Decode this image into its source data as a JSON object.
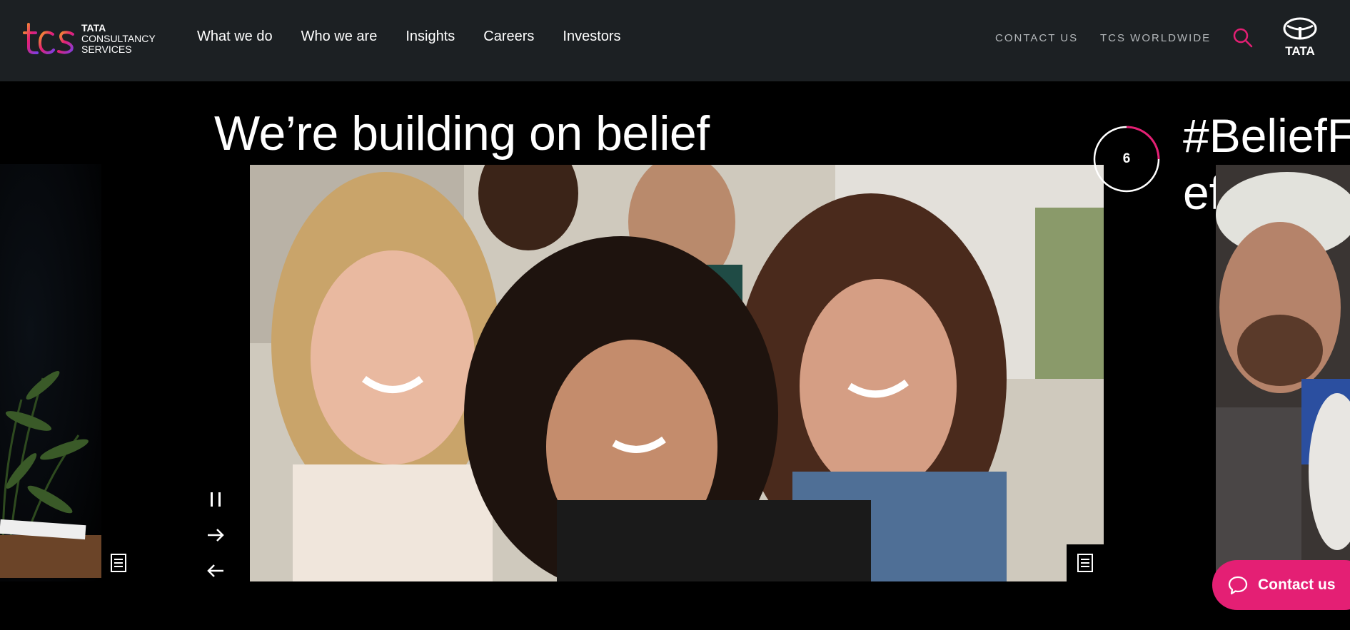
{
  "header": {
    "logo": {
      "mark": "tcs",
      "line1": "TATA",
      "line2": "CONSULTANCY",
      "line3": "SERVICES"
    },
    "nav": [
      {
        "label": "What we do"
      },
      {
        "label": "Who we are"
      },
      {
        "label": "Insights"
      },
      {
        "label": "Careers"
      },
      {
        "label": "Investors"
      }
    ],
    "utility": {
      "contact_label": "CONTACT US",
      "worldwide_label": "TCS WORLDWIDE"
    },
    "search_icon": "search-icon",
    "tata_logo_text": "TATA"
  },
  "hero": {
    "title": "We’re building on belief",
    "slide_counter": "6",
    "next_title_line1": "#BeliefF",
    "next_title_line2": "efforts",
    "controls": {
      "pause_icon": "pause-icon",
      "next_icon": "arrow-right-icon",
      "prev_icon": "arrow-left-icon"
    }
  },
  "contact_fab": {
    "label": "Contact us",
    "icon": "chat-bubble-icon"
  },
  "colors": {
    "header_bg": "#1c2023",
    "accent": "#e41f74",
    "page_bg": "#000000",
    "utility_text": "#b4b8bb"
  }
}
